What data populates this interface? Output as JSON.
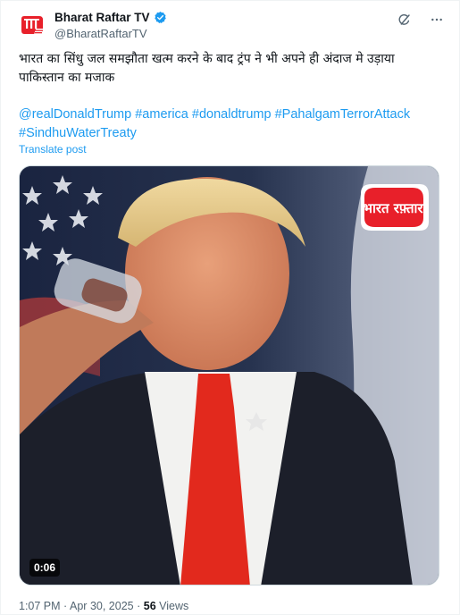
{
  "author": {
    "display_name": "Bharat Raftar TV",
    "handle": "@BharatRaftarTV",
    "avatar_logo_text": "भारत रफ़्तार"
  },
  "icons": {
    "verified": "verified-badge-icon",
    "grok": "grok-icon",
    "more": "more-icon"
  },
  "post": {
    "text": "भारत का सिंधु जल समझौता खत्म करने के बाद ट्रंप ने भी अपने ही अंदाज मे उड़ाया पाकिस्तान का मजाक",
    "hashtags": [
      "@realDonaldTrump",
      "#america",
      "#donaldtrump",
      "#PahalgamTerrorAttack",
      "#SindhuWaterTreaty"
    ],
    "translate_label": "Translate post"
  },
  "video": {
    "duration": "0:06",
    "watermark_text": "भारत रफ़्तार"
  },
  "meta": {
    "time": "1:07 PM",
    "separator": "·",
    "date": "Apr 30, 2025",
    "views_count": "56",
    "views_label": "Views"
  },
  "colors": {
    "accent": "#1d9bf0",
    "text": "#0f1419",
    "secondary": "#536471",
    "brand_red": "#e8202a"
  }
}
